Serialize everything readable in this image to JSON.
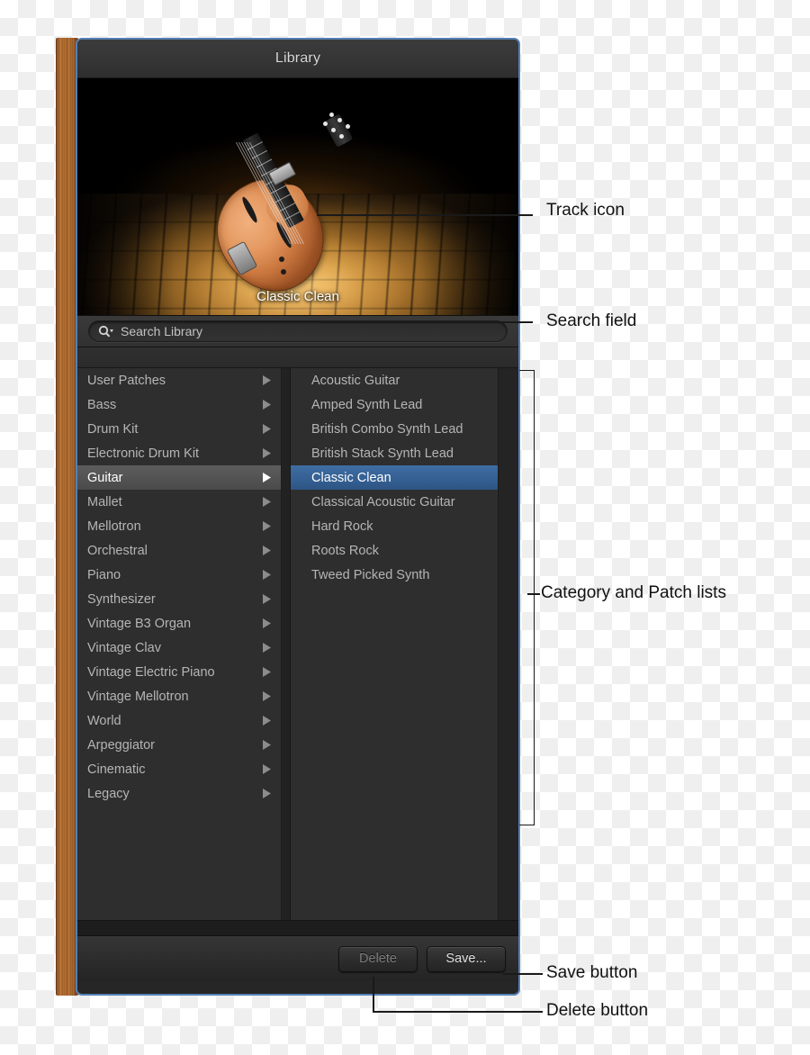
{
  "window": {
    "title": "Library",
    "border_color": "#5580b4"
  },
  "track_icon": {
    "caption": "Classic Clean",
    "description": "hollow-body archtop electric guitar on a spotlit wooden stage floor"
  },
  "search": {
    "placeholder": "Search Library",
    "value": "",
    "icon": "search-icon"
  },
  "categories": [
    {
      "label": "User Patches",
      "selected": false
    },
    {
      "label": "Bass",
      "selected": false
    },
    {
      "label": "Drum Kit",
      "selected": false
    },
    {
      "label": "Electronic Drum Kit",
      "selected": false
    },
    {
      "label": "Guitar",
      "selected": true
    },
    {
      "label": "Mallet",
      "selected": false
    },
    {
      "label": "Mellotron",
      "selected": false
    },
    {
      "label": "Orchestral",
      "selected": false
    },
    {
      "label": "Piano",
      "selected": false
    },
    {
      "label": "Synthesizer",
      "selected": false
    },
    {
      "label": "Vintage B3 Organ",
      "selected": false
    },
    {
      "label": "Vintage Clav",
      "selected": false
    },
    {
      "label": "Vintage Electric Piano",
      "selected": false
    },
    {
      "label": "Vintage Mellotron",
      "selected": false
    },
    {
      "label": "World",
      "selected": false
    },
    {
      "label": "Arpeggiator",
      "selected": false
    },
    {
      "label": "Cinematic",
      "selected": false
    },
    {
      "label": "Legacy",
      "selected": false
    }
  ],
  "patches": [
    {
      "label": "Acoustic Guitar",
      "selected": false
    },
    {
      "label": "Amped Synth Lead",
      "selected": false
    },
    {
      "label": "British Combo Synth Lead",
      "selected": false
    },
    {
      "label": "British Stack Synth Lead",
      "selected": false
    },
    {
      "label": "Classic Clean",
      "selected": true
    },
    {
      "label": "Classical Acoustic Guitar",
      "selected": false
    },
    {
      "label": "Hard Rock",
      "selected": false
    },
    {
      "label": "Roots Rock",
      "selected": false
    },
    {
      "label": "Tweed Picked Synth",
      "selected": false
    }
  ],
  "toolbar": {
    "delete_label": "Delete",
    "save_label": "Save...",
    "delete_enabled": false
  },
  "annotations": {
    "track_icon": "Track icon",
    "search_field": "Search field",
    "category_and_patch_lists": "Category and Patch lists",
    "save_button": "Save button",
    "delete_button": "Delete button"
  },
  "colors": {
    "selection_blue": "#3f6ea4",
    "window_border": "#5580b4",
    "panel_bg": "#2e2e2e",
    "text": "#b5b5b5"
  }
}
